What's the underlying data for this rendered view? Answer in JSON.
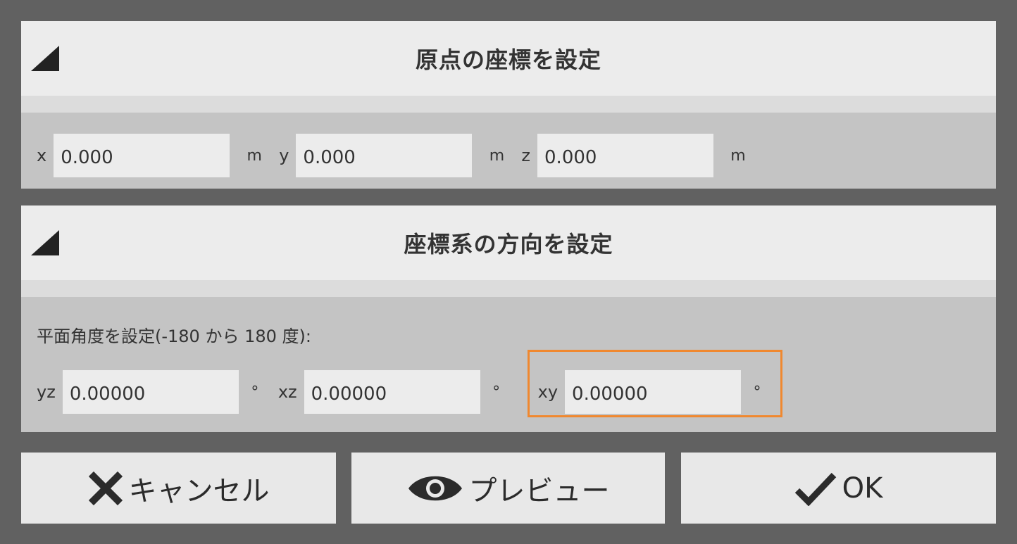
{
  "origin_section": {
    "title": "原点の座標を設定",
    "fields": [
      {
        "label": "x",
        "value": "0.000",
        "unit": "m"
      },
      {
        "label": "y",
        "value": "0.000",
        "unit": "m"
      },
      {
        "label": "z",
        "value": "0.000",
        "unit": "m"
      }
    ]
  },
  "orientation_section": {
    "title": "座標系の方向を設定",
    "hint": "平面角度を設定(-180 から 180 度):",
    "fields": [
      {
        "label": "yz",
        "value": "0.00000",
        "unit": "°"
      },
      {
        "label": "xz",
        "value": "0.00000",
        "unit": "°"
      },
      {
        "label": "xy",
        "value": "0.00000",
        "unit": "°"
      }
    ]
  },
  "buttons": {
    "cancel": "キャンセル",
    "preview": "プレビュー",
    "ok": "OK"
  },
  "colors": {
    "highlight": "#f0882f",
    "background": "#616161"
  }
}
